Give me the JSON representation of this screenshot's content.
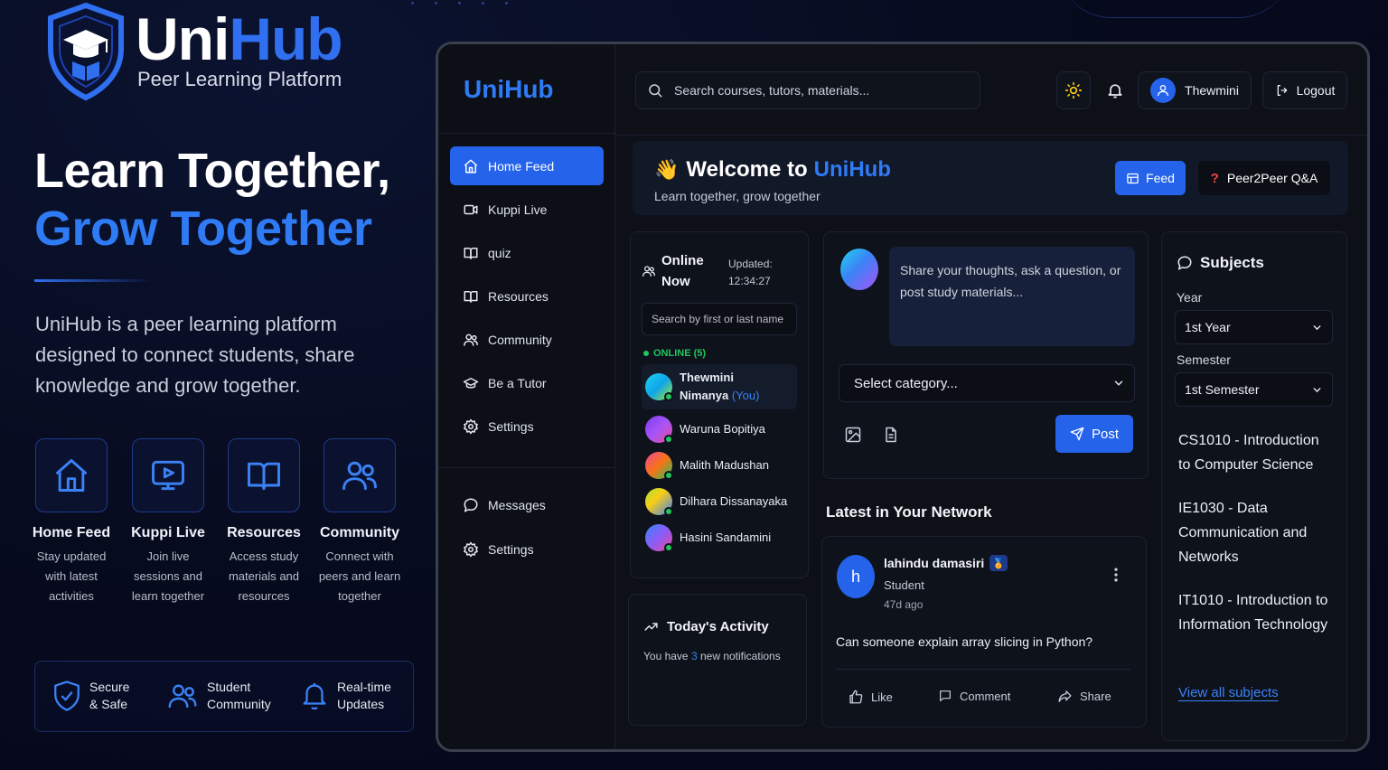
{
  "brand": {
    "name_part1": "Uni",
    "name_part2": "Hub",
    "tagline": "Peer Learning Platform"
  },
  "hero": {
    "line1": "Learn Together,",
    "line2": "Grow Together",
    "description": "UniHub is a peer learning platform designed to connect students, share knowledge and grow together."
  },
  "features": [
    {
      "icon": "home-icon",
      "title": "Home Feed",
      "desc": "Stay updated with latest activities"
    },
    {
      "icon": "video-play-icon",
      "title": "Kuppi Live",
      "desc": "Join live sessions and learn together"
    },
    {
      "icon": "book-open-icon",
      "title": "Resources",
      "desc": "Access study materials and resources"
    },
    {
      "icon": "users-icon",
      "title": "Community",
      "desc": "Connect with peers and learn together"
    }
  ],
  "trust": [
    {
      "icon": "shield-check-icon",
      "line1": "Secure",
      "line2": "& Safe"
    },
    {
      "icon": "users-icon",
      "line1": "Student",
      "line2": "Community"
    },
    {
      "icon": "bell-icon",
      "line1": "Real-time",
      "line2": "Updates"
    }
  ],
  "app": {
    "logo": "UniHub",
    "nav": [
      {
        "icon": "home-icon",
        "label": "Home Feed",
        "active": true
      },
      {
        "icon": "video-icon",
        "label": "Kuppi Live"
      },
      {
        "icon": "book-open-icon",
        "label": "quiz"
      },
      {
        "icon": "book-open-icon",
        "label": "Resources"
      },
      {
        "icon": "users-icon",
        "label": "Community"
      },
      {
        "icon": "graduation-cap-icon",
        "label": "Be a Tutor"
      },
      {
        "icon": "gear-icon",
        "label": "Settings"
      }
    ],
    "nav_bottom": [
      {
        "icon": "chat-bubble-icon",
        "label": "Messages"
      },
      {
        "icon": "gear-icon",
        "label": "Settings"
      }
    ],
    "search_placeholder": "Search courses, tutors, materials...",
    "user_name": "Thewmini",
    "logout_label": "Logout",
    "welcome": {
      "emoji": "👋",
      "title_prefix": "Welcome to",
      "title_brand": "UniHub",
      "subtitle": "Learn together, grow together",
      "feed_label": "Feed",
      "qa_icon": "?",
      "qa_label": "Peer2Peer Q&A"
    },
    "online": {
      "title_line1": "Online",
      "title_line2": "Now",
      "updated_label": "Updated:",
      "updated_time": "12:34:27",
      "search_placeholder": "Search by first or last name",
      "online_label": "ONLINE (5)",
      "users": [
        {
          "name_line1": "Thewmini",
          "name_line2": "Nimanya",
          "you": "(You)",
          "gradient": "linear-gradient(135deg,#22d3ee,#0ea5e9 50%,#a3e635)"
        },
        {
          "name": "Waruna Bopitiya",
          "gradient": "linear-gradient(135deg,#7c3aed,#a855f7 50%,#ec4899)"
        },
        {
          "name": "Malith Madushan",
          "gradient": "linear-gradient(135deg,#ec4899,#f97316 50%,#22c55e)"
        },
        {
          "name": "Dilhara Dissanayaka",
          "gradient": "linear-gradient(135deg,#a3e635,#facc15 40%,#3b82f6)"
        },
        {
          "name": "Hasini Sandamini",
          "gradient": "linear-gradient(135deg,#3b82f6,#8b5cf6 50%,#ec4899)"
        }
      ]
    },
    "activity": {
      "title": "Today's Activity",
      "prefix": "You have",
      "count": "3",
      "suffix": "new notifications"
    },
    "composer": {
      "placeholder": "Share your thoughts, ask a question, or post study materials...",
      "category_placeholder": "Select category...",
      "post_label": "Post"
    },
    "latest_title": "Latest in Your Network",
    "post": {
      "avatar_letter": "h",
      "author": "lahindu damasiri",
      "badge": "🏅",
      "role": "Student",
      "time": "47d ago",
      "text": "Can someone explain array slicing in Python?",
      "like_label": "Like",
      "comment_label": "Comment",
      "share_label": "Share"
    },
    "subjects": {
      "title": "Subjects",
      "year_label": "Year",
      "year_value": "1st Year",
      "semester_label": "Semester",
      "semester_value": "1st Semester",
      "items": [
        "CS1010 - Introduction to Computer Science",
        "IE1030 - Data Communication and Networks",
        "IT1010 - Introduction to Information Technology"
      ],
      "view_all": "View all subjects"
    }
  },
  "colors": {
    "accent": "#2563eb",
    "brand_blue": "#2f7af5",
    "online_green": "#22c55e",
    "background": "#060a1c"
  }
}
